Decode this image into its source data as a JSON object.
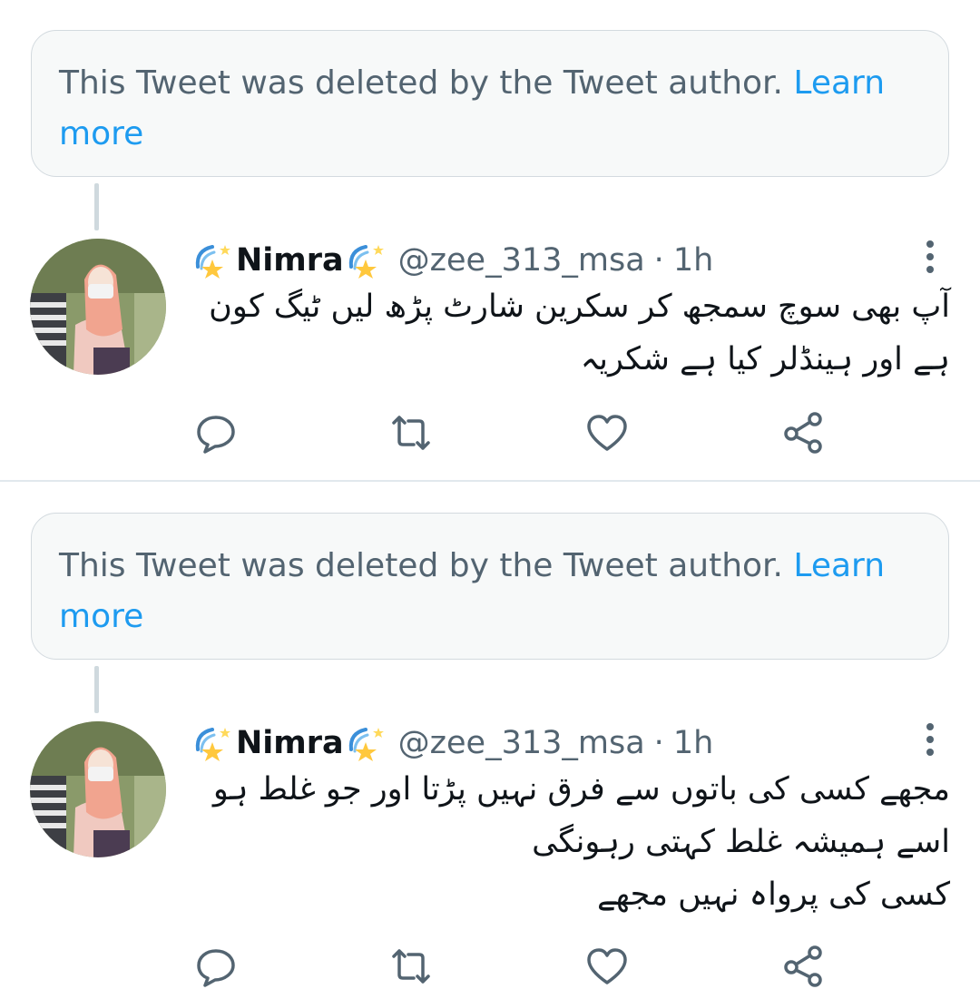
{
  "tweets": [
    {
      "deleted_notice": {
        "text": "This Tweet was deleted by the Tweet author. ",
        "link": "Learn more"
      },
      "author": {
        "name": "Nimra",
        "handle": "@zee_313_msa",
        "separator": "·",
        "time": "1h",
        "name_decoration_icon": "shooting-star-icon"
      },
      "text": "آپ بھی سوچ سمجھ کر سکرین شارٹ پڑھ لیں ٹیگ کون\nہے اور ہینڈلر کیا ہے شکریہ",
      "actions": [
        "reply-icon",
        "retweet-icon",
        "like-icon",
        "share-icon"
      ]
    },
    {
      "deleted_notice": {
        "text": "This Tweet was deleted by the Tweet author. ",
        "link": "Learn more"
      },
      "author": {
        "name": "Nimra",
        "handle": "@zee_313_msa",
        "separator": "·",
        "time": "1h",
        "name_decoration_icon": "shooting-star-icon"
      },
      "text": "مجھے کسی کی باتوں سے فرق نہیں پڑتا اور جو غلط ہو\nاسے ہمیشہ غلط کہتی رہونگی\nکسی کی پرواہ نہیں مجھے",
      "actions": [
        "reply-icon",
        "retweet-icon",
        "like-icon",
        "share-icon"
      ]
    }
  ],
  "colors": {
    "link": "#1d9bf0",
    "secondary_text": "#536471",
    "primary_text": "#0f1419",
    "notice_background": "#f7f9f9"
  }
}
